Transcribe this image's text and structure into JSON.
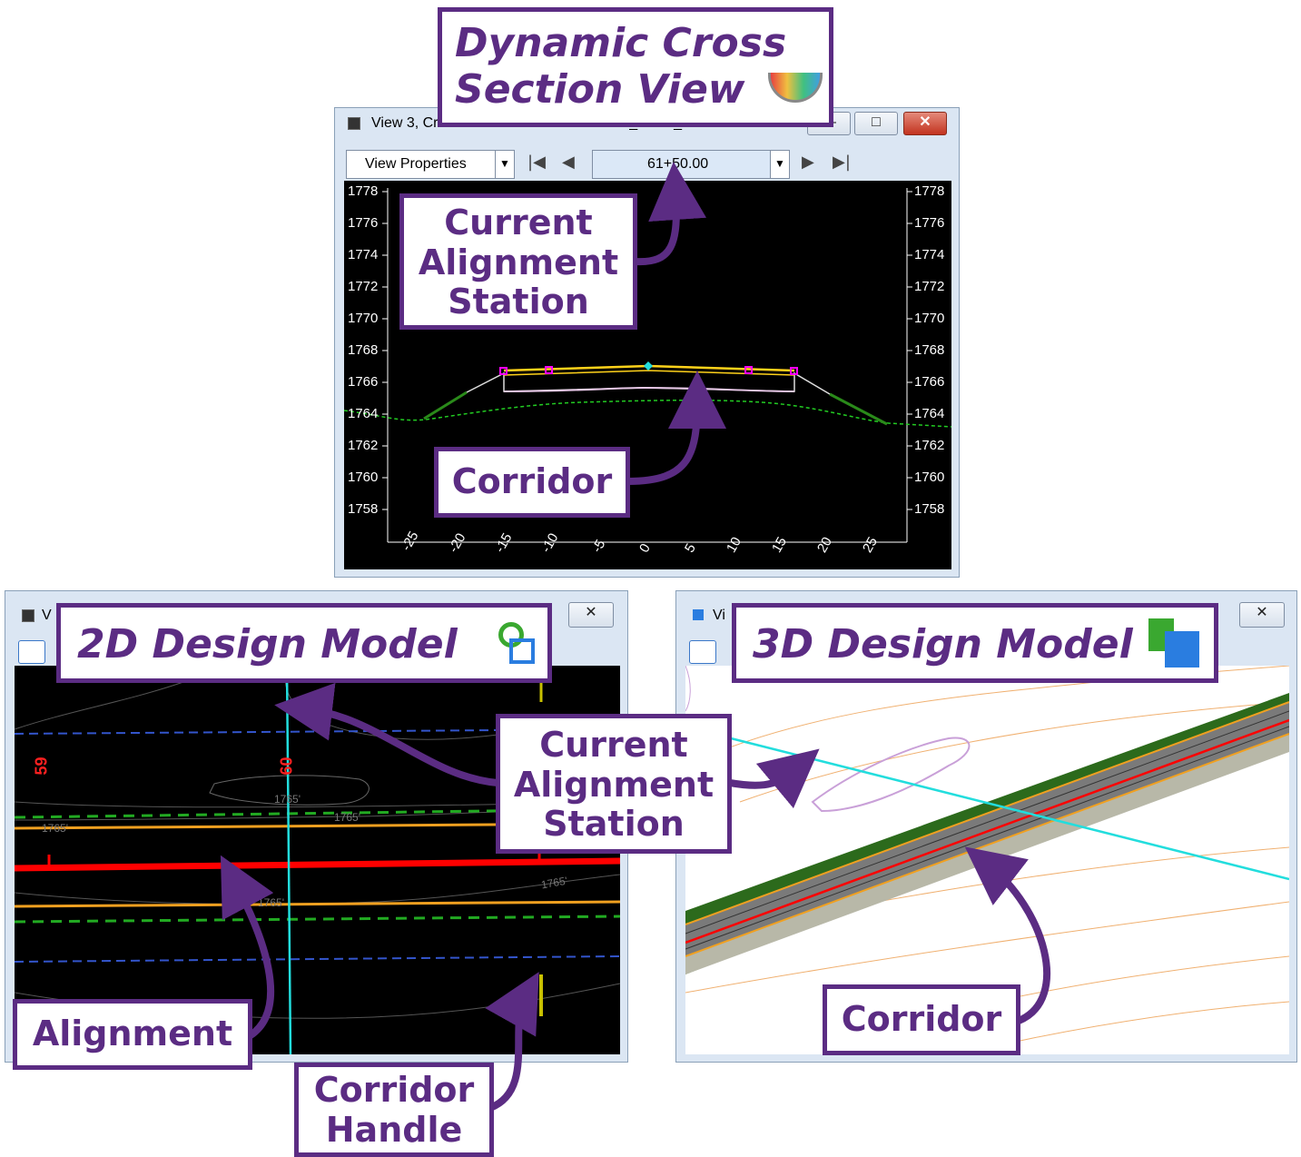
{
  "cross_section_window": {
    "title": "View 3, Cross Section - Corridor: CORR_MAIN_Red Rock Pl...",
    "view_properties_label": "View Properties",
    "station_value": "61+50.00",
    "y_ticks": [
      "1778",
      "1776",
      "1774",
      "1772",
      "1770",
      "1768",
      "1766",
      "1764",
      "1762",
      "1760",
      "1758"
    ],
    "x_ticks": [
      "-25",
      "-20",
      "-15",
      "-10",
      "-5",
      "0",
      "5",
      "10",
      "15",
      "20",
      "25"
    ],
    "window_buttons": {
      "minimize": "—",
      "maximize": "□",
      "close": "✕"
    }
  },
  "design_2d_window": {
    "title": "V",
    "station_labels": [
      "59",
      "60"
    ],
    "contour_labels": [
      "1765'",
      "1765'",
      "1765'",
      "1765'",
      "1765'"
    ],
    "close": "✕"
  },
  "design_3d_window": {
    "title": "Vi",
    "close": "✕"
  },
  "callouts": {
    "dynamic_cross_section": [
      "Dynamic Cross",
      "Section View"
    ],
    "current_station_top": [
      "Current",
      "Alignment",
      "Station"
    ],
    "corridor_top": "Corridor",
    "model_2d": "2D Design Model",
    "model_3d": "3D Design Model",
    "current_station_mid": [
      "Current",
      "Alignment",
      "Station"
    ],
    "alignment": "Alignment",
    "corridor_handle": [
      "Corridor",
      "Handle"
    ],
    "corridor_3d": "Corridor"
  },
  "colors": {
    "callout_purple": "#5b2c83",
    "alignment_red": "#ff0000",
    "station_cyan": "#22dddd",
    "edge_orange": "#f0a020",
    "toe_green": "#1a8a1a"
  }
}
